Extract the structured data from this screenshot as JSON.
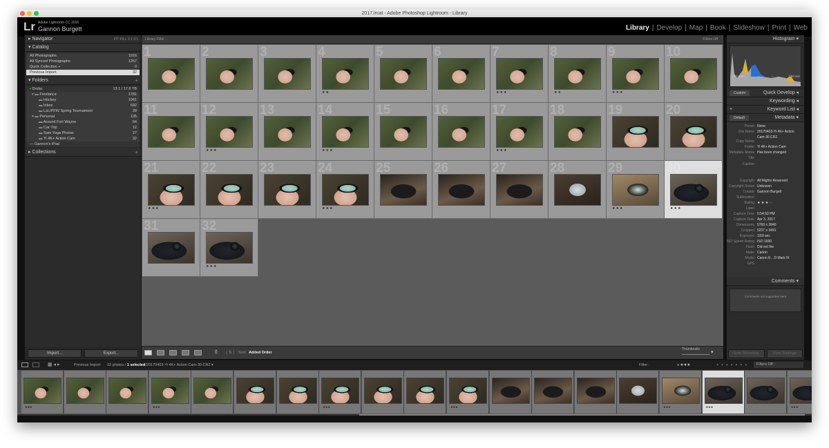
{
  "window": {
    "title": "2017.lrcat - Adobe Photoshop Lightroom - Library"
  },
  "identity": {
    "logo": "Lr",
    "product": "Adobe Lightroom CC 2015",
    "user": "Gannon Burgett"
  },
  "modules": [
    "Library",
    "Develop",
    "Map",
    "Book",
    "Slideshow",
    "Print",
    "Web"
  ],
  "active_module": "Library",
  "left": {
    "navigator": {
      "title": "Navigator",
      "zoom": "FIT  FILL  1:1  3:1"
    },
    "catalog": {
      "title": "Catalog",
      "items": [
        {
          "label": "All Photographs",
          "count": "1916"
        },
        {
          "label": "All Synced Photographs",
          "count": "1267"
        },
        {
          "label": "Quick Collection +",
          "count": "0"
        },
        {
          "label": "Previous Import",
          "count": "32"
        }
      ]
    },
    "folders": {
      "title": "Folders",
      "volume": "Drobo",
      "volume_size": "13.1 / 17.6 TB",
      "items": [
        {
          "label": "Freelance",
          "count": "1781",
          "level": 0
        },
        {
          "label": "Hockey",
          "count": "1061",
          "level": 1
        },
        {
          "label": "Inbox",
          "count": "692",
          "level": 1
        },
        {
          "label": "LoL/PFW Spring Tournament",
          "count": "28",
          "level": 1
        },
        {
          "label": "Personal",
          "count": "135",
          "level": 0
        },
        {
          "label": "Around Fort Wayne",
          "count": "64",
          "level": 1
        },
        {
          "label": "Car Trip",
          "count": "12",
          "level": 1
        },
        {
          "label": "Sam Yoga Photos",
          "count": "27",
          "level": 1
        },
        {
          "label": "Yi 4K+ Action Cam",
          "count": "32",
          "level": 1
        }
      ],
      "volume2": "Gannon's iPad"
    },
    "collections": {
      "title": "Collections"
    },
    "import": "Import...",
    "export": "Export..."
  },
  "filter_bar": {
    "label": "Library Filter :",
    "tabs": [
      "Text",
      "Attribute",
      "Metadata",
      "None"
    ],
    "active": "None",
    "filters": "Filters Off"
  },
  "grid": {
    "selected": 30,
    "photos": [
      {
        "n": 1,
        "scene": "hand-green",
        "stars": 0
      },
      {
        "n": 2,
        "scene": "hand-green",
        "stars": 0
      },
      {
        "n": 3,
        "scene": "hand-green",
        "stars": 0
      },
      {
        "n": 4,
        "scene": "hand-green",
        "stars": 2
      },
      {
        "n": 5,
        "scene": "hand-green",
        "stars": 0
      },
      {
        "n": 6,
        "scene": "hand-green",
        "stars": 0
      },
      {
        "n": 7,
        "scene": "hand-green",
        "stars": 3
      },
      {
        "n": 8,
        "scene": "hand-green",
        "stars": 2
      },
      {
        "n": 9,
        "scene": "hand-green",
        "stars": 3
      },
      {
        "n": 10,
        "scene": "hand-green",
        "stars": 0
      },
      {
        "n": 11,
        "scene": "hand-green",
        "stars": 0
      },
      {
        "n": 12,
        "scene": "hand-green",
        "stars": 3
      },
      {
        "n": 13,
        "scene": "hand-green",
        "stars": 0
      },
      {
        "n": 14,
        "scene": "hand-green",
        "stars": 3
      },
      {
        "n": 15,
        "scene": "hand-green",
        "stars": 0
      },
      {
        "n": 16,
        "scene": "hand-green",
        "stars": 0
      },
      {
        "n": 17,
        "scene": "hand-green",
        "stars": 3
      },
      {
        "n": 18,
        "scene": "hand-green",
        "stars": 0
      },
      {
        "n": 19,
        "scene": "hand-screen",
        "stars": 0
      },
      {
        "n": 20,
        "scene": "hand-screen",
        "stars": 0
      },
      {
        "n": 21,
        "scene": "hand-screen",
        "stars": 3
      },
      {
        "n": 22,
        "scene": "hand-screen",
        "stars": 0
      },
      {
        "n": 23,
        "scene": "hand-screen",
        "stars": 0
      },
      {
        "n": 24,
        "scene": "hand-screen",
        "stars": 3
      },
      {
        "n": 25,
        "scene": "camera-wood",
        "stars": 0
      },
      {
        "n": 26,
        "scene": "camera-wood",
        "stars": 0
      },
      {
        "n": 27,
        "scene": "camera-wood",
        "stars": 0
      },
      {
        "n": 28,
        "scene": "camera-screen-white",
        "stars": 0
      },
      {
        "n": 29,
        "scene": "camera-screen",
        "stars": 3
      },
      {
        "n": 30,
        "scene": "camera-dark",
        "stars": 3
      },
      {
        "n": 31,
        "scene": "camera-dark",
        "stars": 0
      },
      {
        "n": 32,
        "scene": "camera-dark",
        "stars": 3
      }
    ]
  },
  "toolbar": {
    "sort_label": "Sort:",
    "sort_value": "Added Order",
    "thumbnails": "Thumbnails"
  },
  "right": {
    "histogram": {
      "title": "Histogram",
      "iso": "ISO 1600",
      "lens": "–",
      "aperture": "–",
      "shutter": "1/60 sec",
      "original": "Original Photo"
    },
    "quick_develop": {
      "title": "Quick Develop",
      "preset": "Custom"
    },
    "keywording": "Keywording",
    "keyword_list": "Keyword List",
    "metadata": {
      "title": "Metadata",
      "preset_select": "Default",
      "fields": [
        {
          "k": "Preset",
          "v": "None"
        },
        {
          "k": "File Name",
          "v": "20170403-Yi 4K+ Action Cam-30.CR2"
        },
        {
          "k": "Copy Name",
          "v": ""
        },
        {
          "k": "Folder",
          "v": "Yi 4K+ Action Cam"
        },
        {
          "k": "Metadata Status",
          "v": "Has been changed"
        },
        {
          "k": "Title",
          "v": ""
        },
        {
          "k": "Caption",
          "v": ""
        },
        {
          "k": "Copyright",
          "v": "All Rights Reserved"
        },
        {
          "k": "Copyright Status",
          "v": "Unknown"
        },
        {
          "k": "Creator",
          "v": "Gannon Burgett"
        },
        {
          "k": "Sublocation",
          "v": ""
        },
        {
          "k": "Rating",
          "v": "★ ★ ★ · ·"
        },
        {
          "k": "Label",
          "v": ""
        },
        {
          "k": "Capture Time",
          "v": "5:54:50 PM"
        },
        {
          "k": "Capture Date",
          "v": "Apr 3, 2017"
        },
        {
          "k": "Dimensions",
          "v": "5760 x 3840"
        },
        {
          "k": "Cropped",
          "v": "5237 x 3491"
        },
        {
          "k": "Exposure",
          "v": "1/60 sec"
        },
        {
          "k": "ISO Speed Rating",
          "v": "ISO 1600"
        },
        {
          "k": "Flash",
          "v": "Did not fire"
        },
        {
          "k": "Make",
          "v": "Canon"
        },
        {
          "k": "Model",
          "v": "Canon E…D Mark III"
        },
        {
          "k": "GPS",
          "v": ""
        }
      ]
    },
    "comments": {
      "title": "Comments",
      "text": "Comments not supported here"
    },
    "sync_metadata": "Sync Metadata",
    "sync_settings": "Sync Settings"
  },
  "filmstrip": {
    "source": "Previous Import",
    "count": "32 photos /",
    "selected": "1 selected",
    "path": "/20170403-Yi 4K+ Action Cam-30.CR2 ▾",
    "filter_label": "Filter :",
    "rating_filter": "≥ ★★★",
    "filter_preset": "Filters Off",
    "first_photo": 14
  }
}
